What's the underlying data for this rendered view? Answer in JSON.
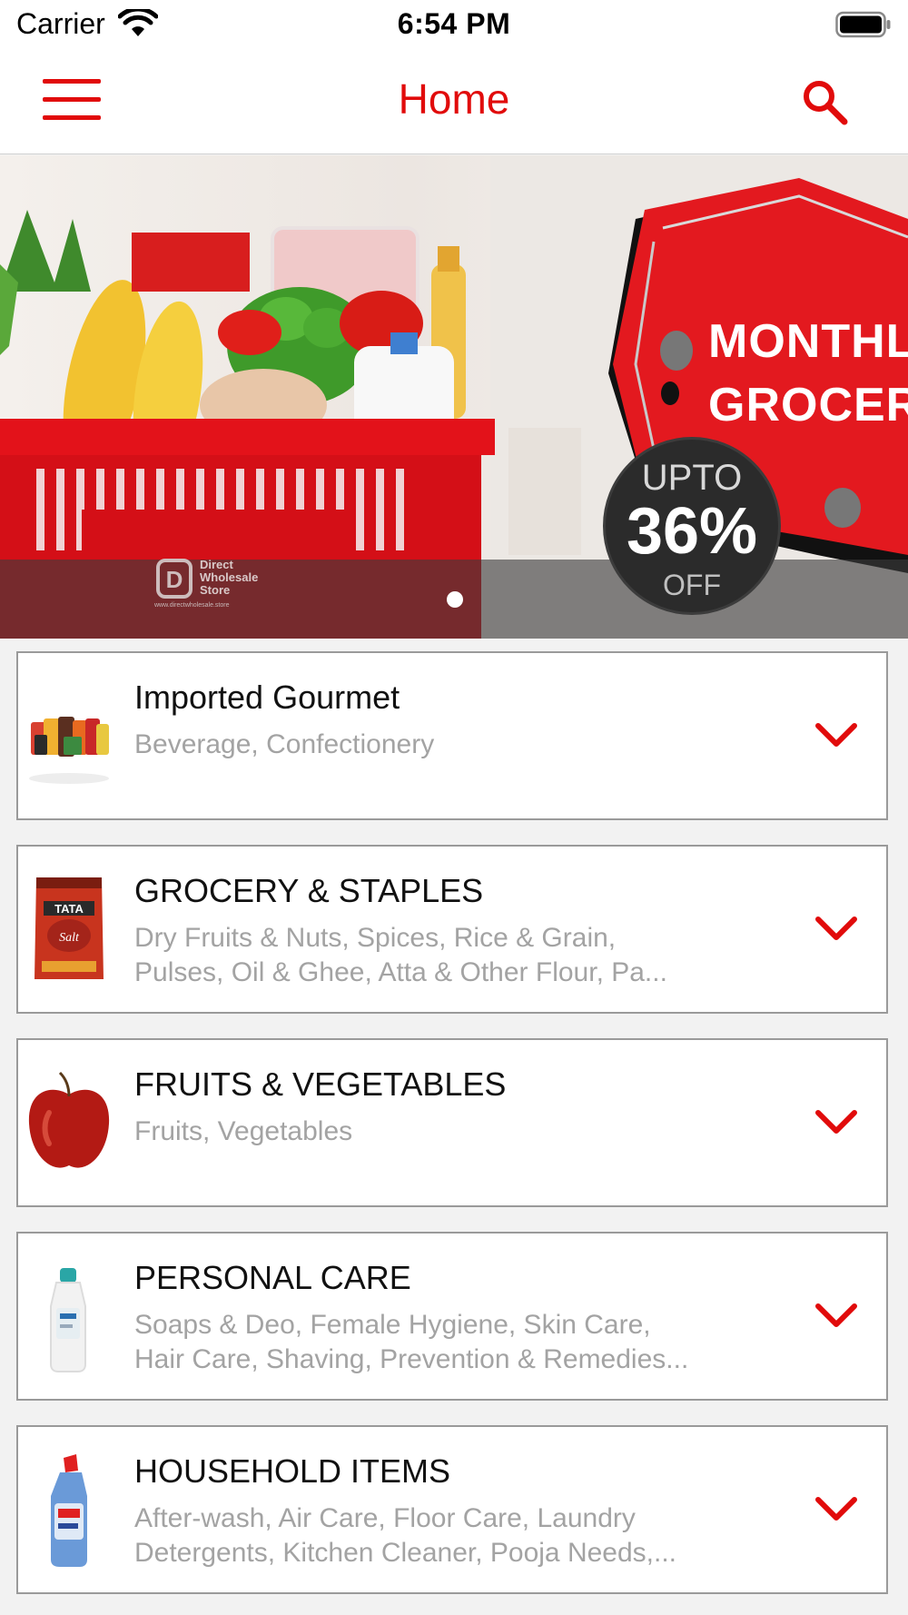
{
  "status_bar": {
    "carrier": "Carrier",
    "time": "6:54 PM"
  },
  "nav": {
    "title": "Home",
    "menu_icon": "hamburger-menu-icon",
    "search_icon": "search-icon",
    "accent_color": "#e10b0b"
  },
  "banner": {
    "promo_line1": "MONTHL",
    "promo_line2": "GROCER",
    "badge_upto": "UPTO",
    "badge_percent": "36%",
    "badge_off": "OFF",
    "logo_text": [
      "Direct",
      "Wholesale",
      "Store"
    ],
    "logo_url": "www.directwholesale.store",
    "slide_count": 1,
    "active_slide": 1
  },
  "categories": [
    {
      "title": "Imported Gourmet",
      "subtitle_lines": [
        "Beverage, Confectionery"
      ],
      "image": "gourmet-products-image"
    },
    {
      "title": "GROCERY & STAPLES",
      "subtitle_lines": [
        "Dry Fruits & Nuts, Spices, Rice & Grain,",
        "Pulses, Oil & Ghee, Atta & Other Flour, Pa..."
      ],
      "image": "tata-salt-image"
    },
    {
      "title": "FRUITS & VEGETABLES",
      "subtitle_lines": [
        "Fruits, Vegetables"
      ],
      "image": "red-apple-image"
    },
    {
      "title": "PERSONAL CARE",
      "subtitle_lines": [
        "Soaps & Deo, Female Hygiene, Skin Care,",
        "Hair Care, Shaving, Prevention & Remedies..."
      ],
      "image": "shampoo-bottle-image"
    },
    {
      "title": "HOUSEHOLD ITEMS",
      "subtitle_lines": [
        "After-wash, Air Care, Floor Care, Laundry",
        "Detergents, Kitchen Cleaner, Pooja Needs,..."
      ],
      "image": "toilet-cleaner-image"
    }
  ]
}
